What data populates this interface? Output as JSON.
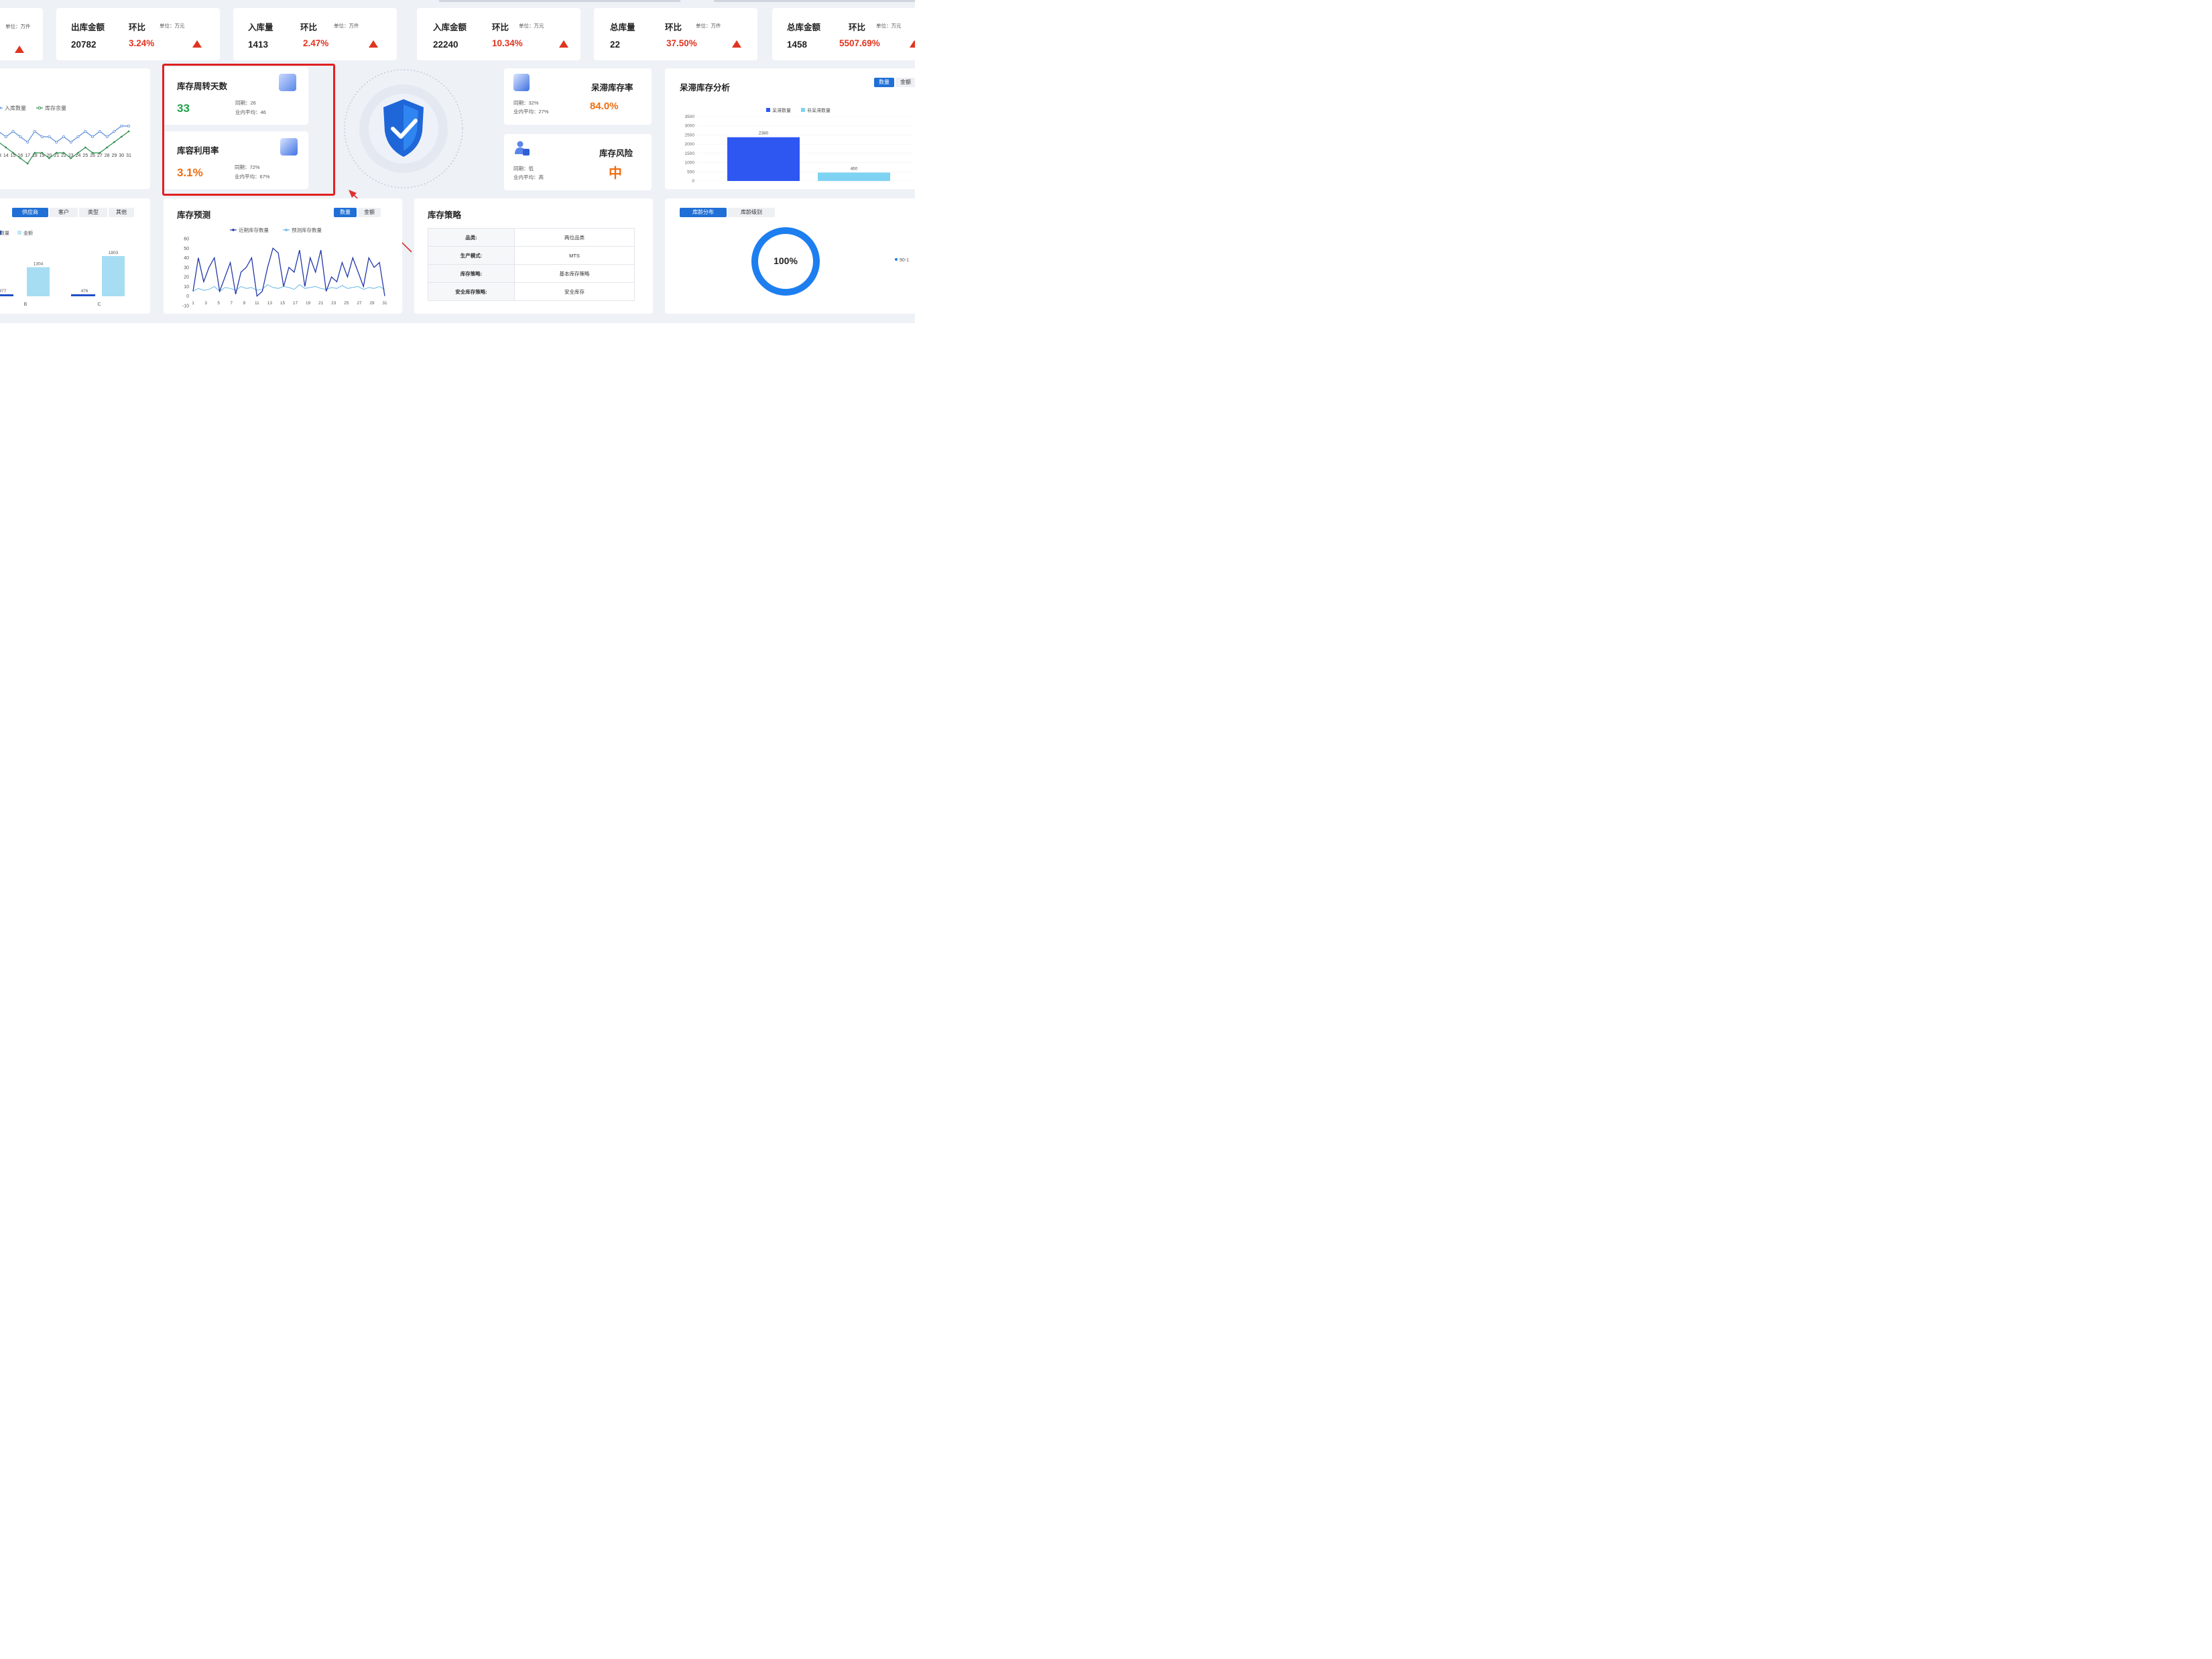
{
  "kpis": [
    {
      "label": "",
      "ratio_label": "",
      "unit": "单位：万件",
      "value": "",
      "change": ""
    },
    {
      "label": "出库金额",
      "ratio_label": "环比",
      "unit": "单位：万元",
      "value": "20782",
      "change": "3.24%"
    },
    {
      "label": "入库量",
      "ratio_label": "环比",
      "unit": "单位：万件",
      "value": "1413",
      "change": "2.47%"
    },
    {
      "label": "入库金额",
      "ratio_label": "环比",
      "unit": "单位：万元",
      "value": "22240",
      "change": "10.34%"
    },
    {
      "label": "总库量",
      "ratio_label": "环比",
      "unit": "单位：万件",
      "value": "22",
      "change": "37.50%"
    },
    {
      "label": "总库金额",
      "ratio_label": "环比",
      "unit": "单位：万元",
      "value": "1458",
      "change": "5507.69%"
    }
  ],
  "turnover": {
    "title": "库存周转天数",
    "value": "33",
    "yoy": "同期：26",
    "industry": "业内平均：46"
  },
  "utilization": {
    "title": "库容利用率",
    "value": "3.1%",
    "yoy": "同期：72%",
    "industry": "业内平均：67%"
  },
  "stagnant_rate": {
    "title": "呆滞库存率",
    "value": "84.0%",
    "yoy": "同期：32%",
    "industry": "业内平均：27%"
  },
  "risk": {
    "title": "库存风险",
    "value": "中",
    "yoy": "同期：低",
    "industry": "业内平均：高"
  },
  "trend_chart": {
    "legend": [
      "入库数量",
      "库存余量"
    ],
    "x_labels": [
      "13",
      "14",
      "15",
      "16",
      "17",
      "18",
      "19",
      "20",
      "21",
      "22",
      "23",
      "24",
      "25",
      "26",
      "27",
      "28",
      "29",
      "30",
      "31"
    ],
    "series_a": [
      7,
      6,
      7,
      6,
      5,
      7,
      6,
      6,
      5,
      6,
      5,
      6,
      7,
      6,
      7,
      6,
      7,
      8,
      8
    ],
    "series_b": [
      5,
      4,
      3,
      2,
      1,
      3,
      3,
      2,
      3,
      3,
      2,
      3,
      4,
      3,
      3,
      4,
      5,
      6,
      7
    ]
  },
  "supplier_chart": {
    "tabs": [
      "供应商",
      "客户",
      "类型",
      "其他"
    ],
    "legend": [
      "数量",
      "金额"
    ],
    "x_labels": [
      "B",
      "C"
    ],
    "small_values": [
      "477",
      "476"
    ],
    "values": [
      1304,
      1803
    ],
    "value_labels": [
      "1304",
      "1803"
    ]
  },
  "stagnant_analysis": {
    "title": "呆滞库存分析",
    "tabs": [
      "数量",
      "金额"
    ],
    "legend": [
      "呆滞数量",
      "非呆滞数量"
    ],
    "y_ticks": [
      "3500",
      "3000",
      "2500",
      "2000",
      "1500",
      "1000",
      "500",
      "0"
    ],
    "ylim": [
      0,
      3500
    ],
    "values": [
      2380,
      460
    ],
    "value_labels": [
      "2380",
      "460"
    ]
  },
  "forecast": {
    "title": "库存预测",
    "tabs": [
      "数量",
      "金额"
    ],
    "legend": [
      "近期库存数量",
      "预测库存数量"
    ],
    "y_ticks": [
      "60",
      "50",
      "40",
      "30",
      "20",
      "10",
      "0",
      "-10"
    ],
    "x_labels": [
      "1",
      "3",
      "5",
      "7",
      "9",
      "11",
      "13",
      "15",
      "17",
      "19",
      "21",
      "23",
      "25",
      "27",
      "29",
      "31"
    ],
    "ylim": [
      -10,
      60
    ],
    "series_actual": [
      5,
      40,
      15,
      30,
      40,
      5,
      20,
      35,
      2,
      25,
      30,
      40,
      0,
      5,
      30,
      50,
      45,
      10,
      30,
      25,
      48,
      10,
      40,
      25,
      48,
      5,
      20,
      15,
      35,
      20,
      40,
      25,
      10,
      40,
      30,
      35,
      0
    ],
    "series_forecast": [
      5,
      8,
      6,
      7,
      10,
      5,
      9,
      8,
      6,
      10,
      8,
      9,
      6,
      7,
      12,
      9,
      8,
      10,
      9,
      7,
      12,
      8,
      9,
      10,
      8,
      7,
      9,
      8,
      11,
      8,
      9,
      10,
      7,
      9,
      8,
      10,
      7
    ]
  },
  "strategy": {
    "title": "库存策略",
    "rows": [
      {
        "key": "品类:",
        "value": "两位品类"
      },
      {
        "key": "生产模式:",
        "value": "MTS"
      },
      {
        "key": "库存策略:",
        "value": "基本库存策略"
      },
      {
        "key": "安全库存策略:",
        "value": "安全库存"
      }
    ]
  },
  "age_panel": {
    "tabs": [
      "库龄分布",
      "库龄级别"
    ],
    "center": "100%",
    "legend": "90-1"
  },
  "colors": {
    "accent": "#1f6fd6",
    "red": "#e0341f",
    "green": "#22a24a",
    "orange": "#ef6d12",
    "bar_blue": "#2e57f2",
    "bar_light": "#7fd3f2"
  }
}
